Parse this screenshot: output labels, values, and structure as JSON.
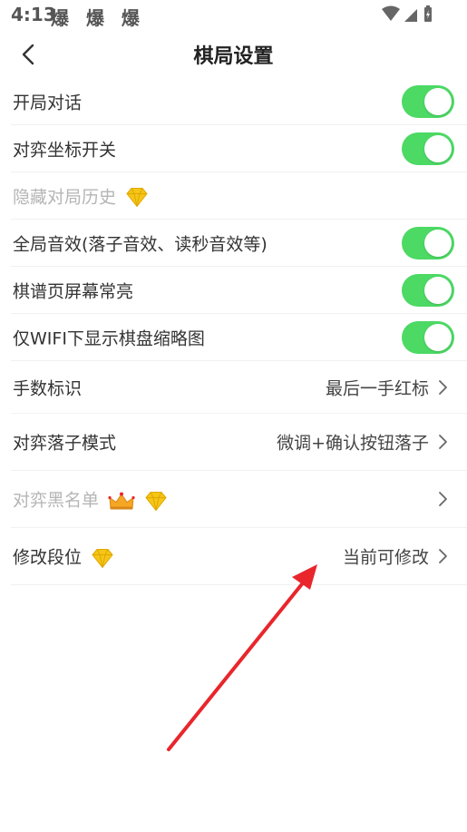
{
  "status_bar": {
    "time": "4:13",
    "notifications": "爆 爆 爆",
    "notification_icon": "app-notification-icon",
    "wifi_icon": "wifi-icon",
    "signal_icon": "signal-icon",
    "battery_icon": "battery-charging-icon"
  },
  "nav": {
    "title": "棋局设置",
    "back_icon": "chevron-left-icon"
  },
  "settings": {
    "open_dialog": {
      "label": "开局对话",
      "enabled": true
    },
    "coords": {
      "label": "对弈坐标开关",
      "enabled": true
    },
    "hide_history": {
      "label": "隐藏对局历史",
      "badge": "diamond-icon"
    },
    "global_sound": {
      "label": "全局音效(落子音效、读秒音效等)",
      "enabled": true
    },
    "screen_on": {
      "label": "棋谱页屏幕常亮",
      "enabled": true
    },
    "wifi_thumbs": {
      "label": "仅WIFI下显示棋盘缩略图",
      "enabled": true
    },
    "move_number": {
      "label": "手数标识",
      "value": "最后一手红标"
    },
    "place_mode": {
      "label": "对弈落子模式",
      "value": "微调+确认按钮落子"
    },
    "blacklist": {
      "label": "对弈黑名单",
      "badges": [
        "crown-icon",
        "diamond-icon"
      ]
    },
    "rank": {
      "label": "修改段位",
      "value": "当前可修改",
      "badge": "diamond-icon"
    }
  },
  "colors": {
    "toggle_on": "#4cd964",
    "arrow": "#e8262c",
    "gem": "#f5c518"
  }
}
